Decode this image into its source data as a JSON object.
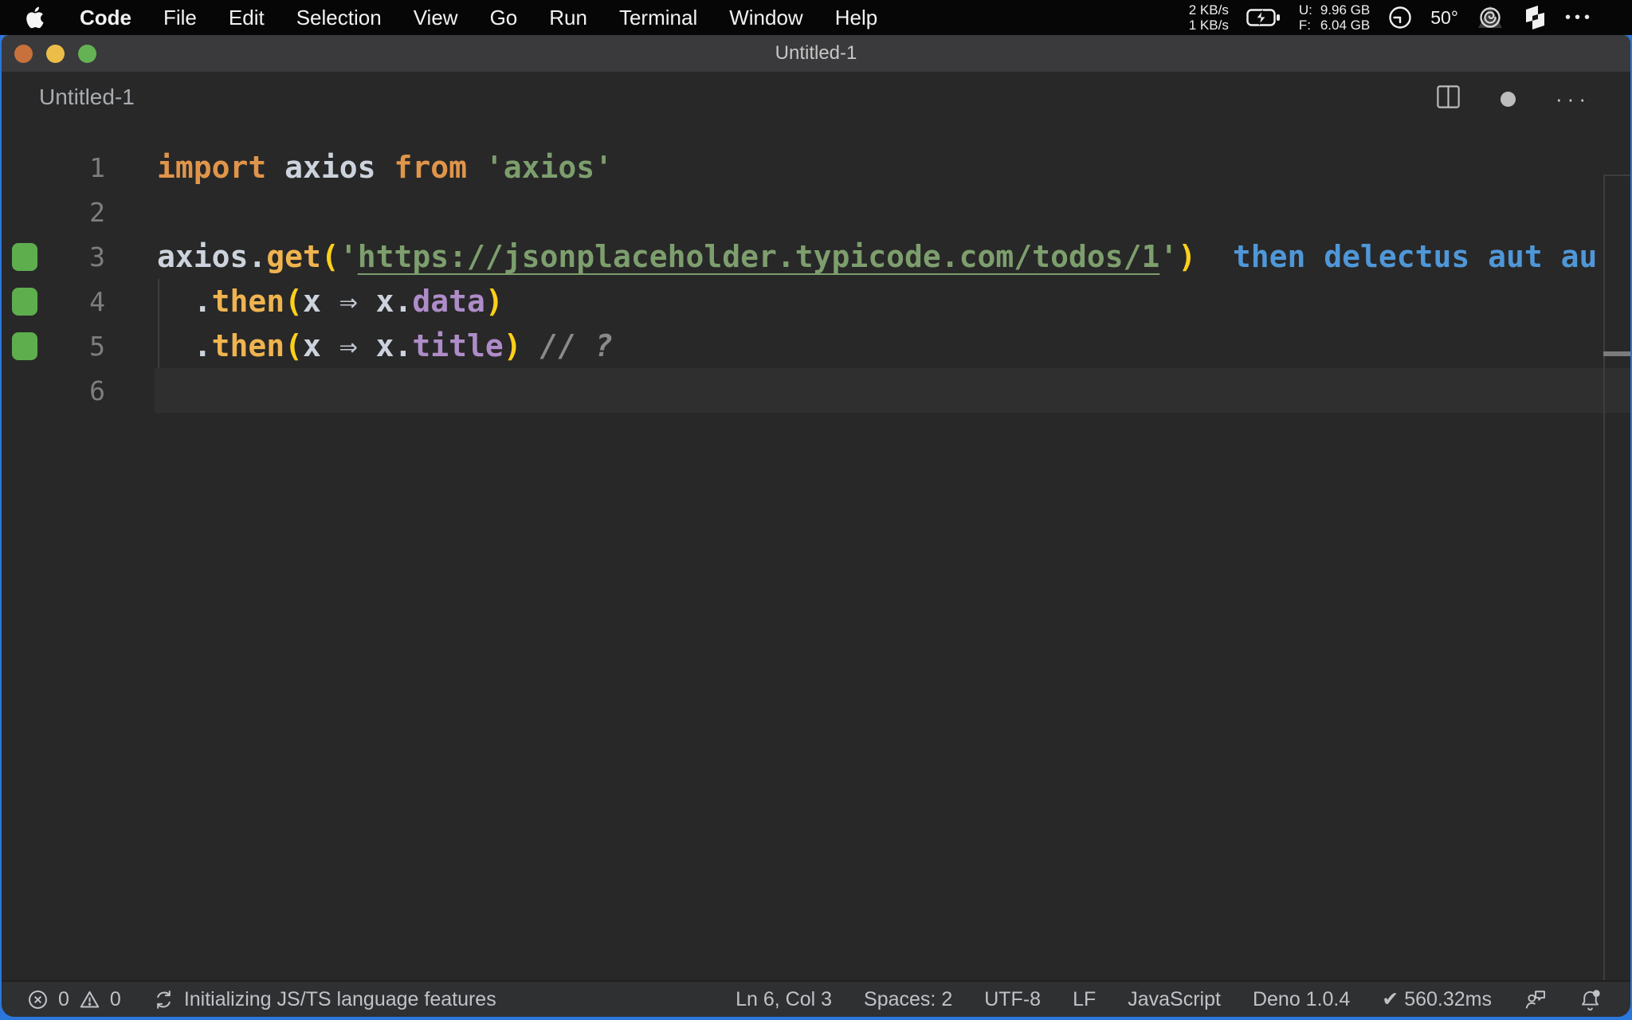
{
  "menu_bar": {
    "items": [
      "Code",
      "File",
      "Edit",
      "Selection",
      "View",
      "Go",
      "Run",
      "Terminal",
      "Window",
      "Help"
    ],
    "status": {
      "net_up": "2 KB/s",
      "net_down": "1 KB/s",
      "mem_used_label": "U:",
      "mem_free_label": "F:",
      "mem_used": "9.96 GB",
      "mem_free": "6.04 GB",
      "temperature": "50°",
      "more_glyph": "•••"
    }
  },
  "window": {
    "title": "Untitled-1",
    "editor_label": "Untitled-1",
    "actions_more_glyph": "···"
  },
  "editor": {
    "ghost_suggestion": "then delectus aut au",
    "lines": [
      {
        "num": "1",
        "covered": false,
        "current": false,
        "tokens": [
          {
            "c": "kw",
            "t": "import"
          },
          {
            "c": "df",
            "t": " axios "
          },
          {
            "c": "kw",
            "t": "from"
          },
          {
            "c": "df",
            "t": " "
          },
          {
            "c": "str",
            "t": "'axios'"
          }
        ]
      },
      {
        "num": "2",
        "covered": false,
        "current": false,
        "tokens": []
      },
      {
        "num": "3",
        "covered": true,
        "current": false,
        "tokens": [
          {
            "c": "df",
            "t": "axios."
          },
          {
            "c": "fn",
            "t": "get"
          },
          {
            "c": "paren",
            "t": "("
          },
          {
            "c": "str",
            "t": "'"
          },
          {
            "c": "url",
            "t": "https://jsonplaceholder.typicode.com/todos/1"
          },
          {
            "c": "str",
            "t": "'"
          },
          {
            "c": "paren",
            "t": ")"
          },
          {
            "c": "ghost",
            "t": "  then delectus aut au"
          }
        ]
      },
      {
        "num": "4",
        "covered": true,
        "current": false,
        "tokens": [
          {
            "c": "df",
            "t": "  ."
          },
          {
            "c": "fn",
            "t": "then"
          },
          {
            "c": "paren",
            "t": "("
          },
          {
            "c": "df",
            "t": "x "
          },
          {
            "c": "arrow",
            "t": "⇒"
          },
          {
            "c": "df",
            "t": " x."
          },
          {
            "c": "prop",
            "t": "data"
          },
          {
            "c": "paren",
            "t": ")"
          }
        ]
      },
      {
        "num": "5",
        "covered": true,
        "current": false,
        "tokens": [
          {
            "c": "df",
            "t": "  ."
          },
          {
            "c": "fn",
            "t": "then"
          },
          {
            "c": "paren",
            "t": "("
          },
          {
            "c": "df",
            "t": "x "
          },
          {
            "c": "arrow",
            "t": "⇒"
          },
          {
            "c": "df",
            "t": " x."
          },
          {
            "c": "prop",
            "t": "title"
          },
          {
            "c": "paren",
            "t": ")"
          },
          {
            "c": "df",
            "t": " "
          },
          {
            "c": "cm",
            "t": "// ?"
          }
        ]
      },
      {
        "num": "6",
        "covered": false,
        "current": true,
        "tokens": []
      }
    ]
  },
  "status_bar": {
    "errors": "0",
    "warnings": "0",
    "message": "Initializing JS/TS language features",
    "cursor": "Ln 6, Col 3",
    "indent": "Spaces: 2",
    "encoding": "UTF-8",
    "eol": "LF",
    "language": "JavaScript",
    "deno": "Deno 1.0.4",
    "check_glyph": "✔",
    "time": "560.32ms"
  },
  "icons": {
    "menu_bar": [
      "apple-icon",
      "battery-charging-icon",
      "clock-icon",
      "swirl-icon",
      "flag-icon",
      "more-dots-icon"
    ],
    "editor": [
      "split-editor-icon",
      "dirty-dot-icon",
      "more-actions-icon",
      "coverage-indicator"
    ],
    "status_bar": [
      "error-icon",
      "warning-icon",
      "sync-icon",
      "check-icon",
      "feedback-icon",
      "bell-icon"
    ]
  },
  "colors": {
    "wallpaper": "#2b77dc",
    "menubar_bg": "#060606",
    "titlebar_bg": "#3a3a3c",
    "editor_bg": "#282828",
    "current_line": "#2f2f2f",
    "statusbar_bg": "#2f3032",
    "coverage_green": "#5fae4e",
    "keyword_orange": "#e0954a",
    "string_green": "#7d9e6d",
    "function_yellow": "#efb44f",
    "paren_yellow": "#ffd01a",
    "property_purple": "#ae8cc9",
    "ghost_blue": "#4f97d8",
    "traffic_close": "#c8713c",
    "traffic_min": "#ecbd49",
    "traffic_max": "#65b254"
  }
}
